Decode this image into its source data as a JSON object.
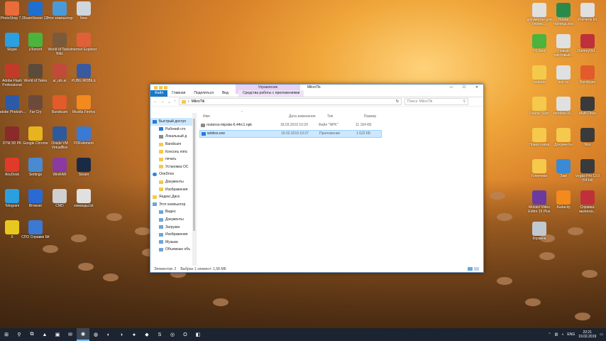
{
  "desktop_left": [
    {
      "label": "PhotoShop 7.3",
      "color": "#e96c3a"
    },
    {
      "label": "TeamViewer 13",
      "color": "#1f6fd1"
    },
    {
      "label": "Этот компьютер",
      "color": "#4a9ad8"
    },
    {
      "label": "New",
      "color": "#cfd6de"
    },
    {
      "label": "Skype",
      "color": "#2aa0e0"
    },
    {
      "label": "uTorrent",
      "color": "#4bb43c"
    },
    {
      "label": "World of Tanks Blitz",
      "color": "#7a5a3a"
    },
    {
      "label": "Internet Explorer",
      "color": "#e0603a"
    },
    {
      "label": "Adobe Flash Professional",
      "color": "#c23b2a"
    },
    {
      "label": "World of Tanks",
      "color": "#5b4b3a"
    },
    {
      "label": "ai_ufo.ai",
      "color": "#c14a3a"
    },
    {
      "label": "PUBG MOBILE",
      "color": "#3a5aa0"
    },
    {
      "label": "Adobe Photosh...",
      "color": "#2d5aa8"
    },
    {
      "label": "Far Cry",
      "color": "#6b4a3a"
    },
    {
      "label": "Bandicam",
      "color": "#e25b2a"
    },
    {
      "label": "Mozilla Firefox",
      "color": "#f28a1e"
    },
    {
      "label": "DTM 3D PK",
      "color": "#8a2a2a"
    },
    {
      "label": "Google Chrome",
      "color": "#e8b41e"
    },
    {
      "label": "Oracle VM VirtualBox",
      "color": "#2d5a9a"
    },
    {
      "label": "PDFelement",
      "color": "#3a7ad5"
    },
    {
      "label": "AnyDesk",
      "color": "#e23a2a"
    },
    {
      "label": "Settings",
      "color": "#4a8ad0"
    },
    {
      "label": "WinRAR",
      "color": "#8a3aa0"
    },
    {
      "label": "Steam",
      "color": "#1a2a45"
    },
    {
      "label": "Telegram",
      "color": "#2aa0e0"
    },
    {
      "label": "Browser",
      "color": "#2a6ad5"
    },
    {
      "label": "CMD",
      "color": "#d0d0d0"
    },
    {
      "label": "команды.txt",
      "color": "#e0e0e0"
    },
    {
      "label": "X",
      "color": "#e8c81e"
    },
    {
      "label": "СПО Справки БК",
      "color": "#3a7ad5"
    }
  ],
  "desktop_right": [
    {
      "label": "документы для бизнес...",
      "color": "#e0e0e0"
    },
    {
      "label": "Новая таблица.xlsx",
      "color": "#2a8a4a"
    },
    {
      "label": "Расчеты.txt",
      "color": "#e0e0e0"
    },
    {
      "label": "HJ блог",
      "color": "#4bb43c"
    },
    {
      "label": "Новый текстовый...",
      "color": "#e0e0e0"
    },
    {
      "label": "DummyVid...",
      "color": "#c0303a"
    },
    {
      "label": "youtube",
      "color": "#f4c94c"
    },
    {
      "label": "text.txt",
      "color": "#e0e0e0"
    },
    {
      "label": "Bandicam",
      "color": "#e25b2a"
    },
    {
      "label": "Routur Scan",
      "color": "#f4c94c"
    },
    {
      "label": "windows10...",
      "color": "#e0e0e0"
    },
    {
      "label": "Multi-Drive",
      "color": "#3a3a3a"
    },
    {
      "label": "Новая папка",
      "color": "#f4c94c"
    },
    {
      "label": "Документы",
      "color": "#f4c94c"
    },
    {
      "label": "Nox",
      "color": "#3a3a3a"
    },
    {
      "label": "Клинчики",
      "color": "#f4c94c"
    },
    {
      "label": "Зам",
      "color": "#3a8ad5"
    },
    {
      "label": "Vegas Pro 13.0 (64-bit)",
      "color": "#3a3a3a"
    },
    {
      "label": "Movavi Video Editor 15 Plus",
      "color": "#6a3aa0"
    },
    {
      "label": "Audacity",
      "color": "#f28a1e"
    },
    {
      "label": "Справка-выписка...",
      "color": "#c0303a"
    },
    {
      "label": "Корзина",
      "color": "#c0c8d0"
    }
  ],
  "window": {
    "title": "MikroTik",
    "context_tab": "Управление",
    "min": "—",
    "max": "☐",
    "close": "✕",
    "ribbon_tabs": [
      {
        "label": "Файл",
        "file": true
      },
      {
        "label": "Главная",
        "file": false
      },
      {
        "label": "Поделиться",
        "file": false
      },
      {
        "label": "Вид",
        "file": false
      },
      {
        "label": "Средства работы с приложениями",
        "file": false,
        "ctx": true
      }
    ],
    "path": "MikroTik",
    "search_placeholder": "Поиск: MikroTik",
    "nav": [
      {
        "label": "Быстрый доступ",
        "icon": "blue",
        "sel": true
      },
      {
        "label": "Рабочий сто",
        "icon": "blue"
      },
      {
        "label": "Локальный д",
        "icon": "gray"
      },
      {
        "label": "Bandicam",
        "icon": "yellow"
      },
      {
        "label": "Консоль mmc",
        "icon": "yellow"
      },
      {
        "label": "печать",
        "icon": "yellow"
      },
      {
        "label": "Установка ОС",
        "icon": "yellow"
      },
      {
        "label": "OneDrive",
        "icon": "cloud"
      },
      {
        "label": "Документы",
        "icon": "yellow"
      },
      {
        "label": "Изображения",
        "icon": "yellow"
      },
      {
        "label": "Яндекс.Диск",
        "icon": "yellow"
      },
      {
        "label": "Этот компьютер",
        "icon": "pc"
      },
      {
        "label": "Видео",
        "icon": "pc"
      },
      {
        "label": "Документы",
        "icon": "pc"
      },
      {
        "label": "Загрузки",
        "icon": "pc"
      },
      {
        "label": "Изображения",
        "icon": "pc"
      },
      {
        "label": "Музыка",
        "icon": "pc"
      },
      {
        "label": "Объемные объ",
        "icon": "pc"
      }
    ],
    "columns": {
      "name": "Имя",
      "date": "Дата изменения",
      "type": "Тип",
      "size": "Размер"
    },
    "files": [
      {
        "name": "routeros-mipsbe-6.44rc1.npk",
        "date": "18.03.2019 10:29",
        "type": "Файл \"NPK\"",
        "size": "11 164 КБ",
        "sel": false
      },
      {
        "name": "winbox.exe",
        "date": "19.02.2019 10:27",
        "type": "Приложение",
        "size": "1 622 КБ",
        "sel": true
      }
    ],
    "status_items": "Элементов: 2",
    "status_selected": "Выбран 1 элемент: 1,58 МБ"
  },
  "taskbar": {
    "start": "⊞",
    "search": "⚲",
    "taskview": "⧉",
    "apps": [
      "▲",
      "▣",
      "✉",
      "◉",
      "◍",
      "◐",
      "◑",
      "●",
      "◆",
      "S",
      "◎",
      "O",
      "◧"
    ],
    "active_index": 3,
    "lang": "ENG",
    "time": "22:21",
    "date": "19.02.2019",
    "notif": "▭"
  }
}
